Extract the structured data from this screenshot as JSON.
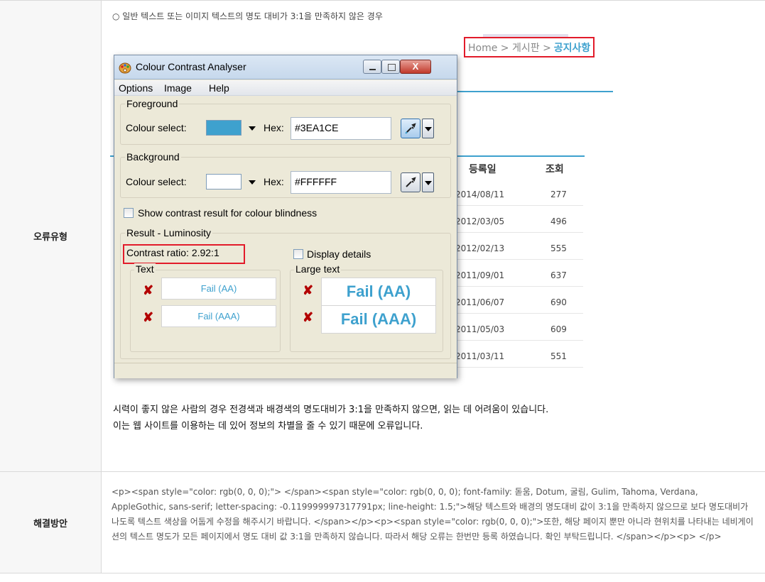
{
  "rows": {
    "error_type_header": "오류유형",
    "solution_header": "해결방안"
  },
  "description": "○ 일반 텍스트 또는 이미지 텍스트의 명도 대비가 3:1을 만족하지 않은 경우",
  "background_page": {
    "breadcrumb_prefix": "Home > 게시판 >",
    "breadcrumb_current": "공지사항",
    "col_date": "등록일",
    "col_views": "조회",
    "rows": [
      {
        "date": "2014/08/11",
        "views": "277"
      },
      {
        "date": "2012/03/05",
        "views": "496"
      },
      {
        "date": "2012/02/13",
        "views": "555"
      },
      {
        "date": "2011/09/01",
        "views": "637"
      },
      {
        "date": "2011/06/07",
        "views": "690"
      },
      {
        "date": "2011/05/03",
        "views": "609"
      },
      {
        "date": "2011/03/11",
        "views": "551"
      }
    ]
  },
  "window": {
    "title": "Colour Contrast Analyser",
    "close_label": "X",
    "menu": [
      "Options",
      "Image",
      "Help"
    ],
    "foreground": {
      "legend": "Foreground",
      "colour_label": "Colour select:",
      "hex_label": "Hex:",
      "hex_value": "#3EA1CE",
      "swatch": "#3EA1CE"
    },
    "background": {
      "legend": "Background",
      "colour_label": "Colour select:",
      "hex_label": "Hex:",
      "hex_value": "#FFFFFF",
      "swatch": "#FFFFFF"
    },
    "colour_blindness_label": "Show contrast result for colour blindness",
    "result": {
      "legend": "Result - Luminosity",
      "contrast_ratio": "Contrast ratio: 2.92:1",
      "display_details": "Display details",
      "text_legend": "Text",
      "large_text_legend": "Large text",
      "text_aa": "Fail (AA)",
      "text_aaa": "Fail (AAA)",
      "large_aa": "Fail (AA)",
      "large_aaa": "Fail (AAA)"
    }
  },
  "explanation": {
    "line1": "시력이 좋지 않은 사람의 경우 전경색과 배경색의 명도대비가 3:1을 만족하지 않으면, 읽는 데 어려움이 있습니다.",
    "line2": "이는 웹 사이트를 이용하는 데 있어 정보의 차별을 줄 수 있기 때문에 오류입니다."
  },
  "solution_html_text": "<p><span style=\"color: rgb(0, 0, 0);\"> </span><span style=\"color: rgb(0, 0, 0); font-family: 돋움, Dotum, 굴림, Gulim, Tahoma, Verdana, AppleGothic, sans-serif; letter-spacing: -0.119999997317791px; line-height: 1.5;\">해당 텍스트와 배경의 명도대비 값이 3:1을 만족하지 않으므로 보다 명도대비가 나도록 텍스트 색상을 어둡게 수정을 해주시기 바랍니다. </span></p><p><span style=\"color: rgb(0, 0, 0);\">또한, 해당 페이지 뿐만 아니라 현위치를 나타내는 네비게이션의 텍스트 명도가 모든 페이지에서 명도 대비 값 3:1을 만족하지 않습니다. 따라서 해당 오류는 한번만 등록 하였습니다. 확인 부탁드립니다. </span></p><p> </p>"
}
